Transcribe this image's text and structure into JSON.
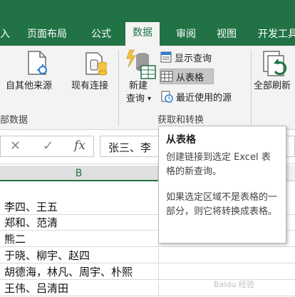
{
  "ribbon_tabs": [
    {
      "label": "入"
    },
    {
      "label": "页面布局"
    },
    {
      "label": "公式"
    },
    {
      "label": "数据",
      "active": true
    },
    {
      "label": "审阅"
    },
    {
      "label": "视图"
    },
    {
      "label": "开发工具"
    }
  ],
  "ribbon": {
    "get_external_data": {
      "from_other_sources": "自其他来源",
      "existing_connections": "现有连接",
      "group_label": "部数据"
    },
    "get_transform": {
      "new_query_line1": "新建",
      "new_query_line2": "查询",
      "new_query_caret": "▾",
      "show_queries": "显示查询",
      "from_table": "从表格",
      "recent_sources": "最近使用的源",
      "group_label": "获取和转换"
    },
    "refresh_all": "全部刷新"
  },
  "formula_bar": {
    "cancel_symbol": "✕",
    "confirm_symbol": "✓",
    "fx_symbol": "fx",
    "formula_text": "张三、李"
  },
  "column_header": {
    "label": "B"
  },
  "rows": [
    {
      "text": "李四、王五"
    },
    {
      "text": "郑和、范清"
    },
    {
      "text": "熊二"
    },
    {
      "text": "于晓、柳宇、赵四"
    },
    {
      "text": "胡德海，林凡、周宇、朴熙"
    },
    {
      "text": "王伟、吕清田"
    }
  ],
  "tooltip": {
    "title": "从表格",
    "paragraph1": "创建链接到选定 Excel 表格的新查询。",
    "paragraph2": "如果选定区域不是表格的一部分，则它将转换成表格。"
  },
  "watermark": "Baidu 经验",
  "colors": {
    "excel_green": "#217346",
    "ribbon_bg": "#f3f3f3",
    "highlight": "#c6c6c6"
  }
}
